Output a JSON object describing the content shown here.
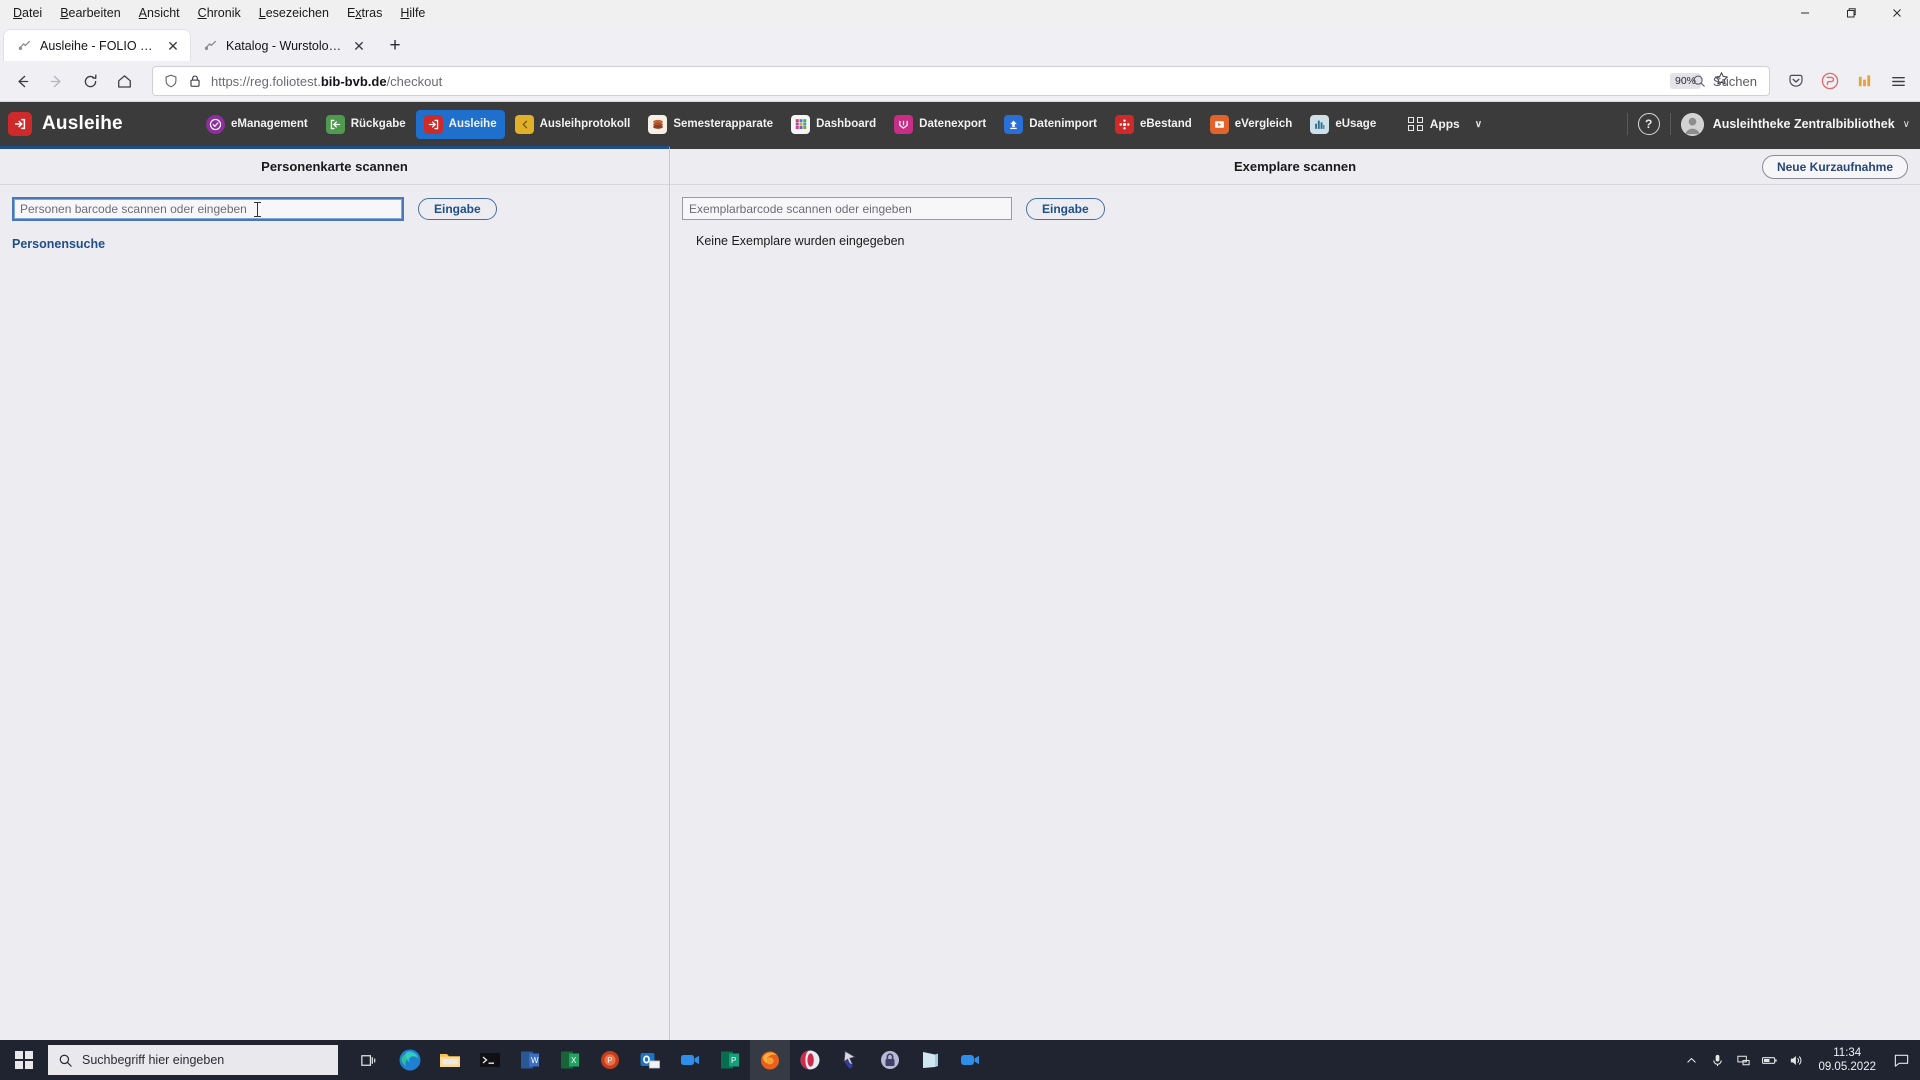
{
  "browser": {
    "menus": [
      {
        "label": "Datei",
        "accel": "D"
      },
      {
        "label": "Bearbeiten",
        "accel": "B"
      },
      {
        "label": "Ansicht",
        "accel": "A"
      },
      {
        "label": "Chronik",
        "accel": "C"
      },
      {
        "label": "Lesezeichen",
        "accel": "L"
      },
      {
        "label": "Extras",
        "accel": "x"
      },
      {
        "label": "Hilfe",
        "accel": "H"
      }
    ],
    "window_controls": {
      "minimize": "minimize-icon",
      "maximize": "maximize-icon",
      "close": "close-icon"
    },
    "tabs": [
      {
        "title": "Ausleihe - FOLIO - FOLIO",
        "active": true,
        "favicon": "page-icon",
        "close": "✕"
      },
      {
        "title": "Katalog - Wurstologia, oder Es",
        "active": false,
        "favicon": "page-icon",
        "close": "✕"
      }
    ],
    "new_tab_label": "+",
    "nav": {
      "back": "back-icon",
      "forward": "forward-icon",
      "reload": "reload-icon",
      "home": "home-icon"
    },
    "urlbar": {
      "shield": "shield-icon",
      "lock": "lock-icon",
      "prefix": "https://reg.foliotest.",
      "domain": "bib-bvb.de",
      "path": "/checkout",
      "zoom_level": "90%",
      "bookmark_star": "star-icon",
      "search_placeholder": "Suchen",
      "search_icon": "search-icon"
    },
    "toolbar_right": [
      {
        "name": "pocket-icon"
      },
      {
        "name": "account-icon"
      },
      {
        "name": "extension-icon"
      },
      {
        "name": "hamburger-menu-icon"
      }
    ]
  },
  "app": {
    "brand": {
      "logo": "ausleihe-logo",
      "name": "Ausleihe"
    },
    "nav_items": [
      {
        "label": "eManagement",
        "icon_color": "#8e2f9e",
        "active": false
      },
      {
        "label": "Rückgabe",
        "icon_color": "#4e9b4e",
        "active": false
      },
      {
        "label": "Ausleihe",
        "icon_color": "#cf2a2a",
        "active": true
      },
      {
        "label": "Ausleihprotokoll",
        "icon_color": "#e0b028",
        "active": false
      },
      {
        "label": "Semesterapparate",
        "icon_color": "#f4f0e6",
        "active": false
      },
      {
        "label": "Dashboard",
        "icon_color": "#f5f5f7",
        "active": false
      },
      {
        "label": "Datenexport",
        "icon_color": "#c92e86",
        "active": false
      },
      {
        "label": "Datenimport",
        "icon_color": "#2a6fd6",
        "active": false
      },
      {
        "label": "eBestand",
        "icon_color": "#cf2a2a",
        "active": false
      },
      {
        "label": "eVergleich",
        "icon_color": "#e2622c",
        "active": false
      },
      {
        "label": "eUsage",
        "icon_color": "#8fb8cf",
        "active": false
      }
    ],
    "apps_button": {
      "label": "Apps",
      "icon": "grid-icon",
      "caret": "∨"
    },
    "help_icon": "help-icon",
    "user": {
      "name": "Ausleihtheke Zentralbibliothek",
      "avatar": "avatar-icon",
      "caret": "∨"
    }
  },
  "main": {
    "left_pane": {
      "title": "Personenkarte scannen",
      "input_placeholder": "Personen barcode scannen oder eingeben",
      "input_value": "",
      "submit_label": "Eingabe",
      "link_label": "Personensuche"
    },
    "right_pane": {
      "title": "Exemplare scannen",
      "action_label": "Neue Kurzaufnahme",
      "input_placeholder": "Exemplarbarcode scannen oder eingeben",
      "input_value": "",
      "submit_label": "Eingabe",
      "empty_message": "Keine Exemplare wurden eingegeben"
    }
  },
  "taskbar": {
    "start": "windows-start-icon",
    "search_placeholder": "Suchbegriff hier eingeben",
    "search_icon": "search-icon",
    "task_view": "task-view-icon",
    "apps": [
      {
        "name": "edge-icon",
        "running": false
      },
      {
        "name": "file-explorer-icon",
        "running": false
      },
      {
        "name": "terminal-icon",
        "running": false
      },
      {
        "name": "word-icon",
        "running": false
      },
      {
        "name": "excel-icon",
        "running": false
      },
      {
        "name": "powerpoint-icon",
        "running": false
      },
      {
        "name": "outlook-icon",
        "running": false
      },
      {
        "name": "teams-icon",
        "running": false
      },
      {
        "name": "publisher-icon",
        "running": false
      },
      {
        "name": "firefox-icon",
        "running": true
      },
      {
        "name": "opera-icon",
        "running": false
      },
      {
        "name": "cursor-tool-icon",
        "running": false
      },
      {
        "name": "keepass-icon",
        "running": false
      },
      {
        "name": "onenote-icon",
        "running": false
      },
      {
        "name": "zoom-icon",
        "running": false
      }
    ],
    "tray": [
      {
        "name": "show-hidden-icons-chevron"
      },
      {
        "name": "microphone-icon"
      },
      {
        "name": "network-icon"
      },
      {
        "name": "battery-icon"
      },
      {
        "name": "volume-icon"
      }
    ],
    "clock": {
      "time": "11:34",
      "date": "09.05.2022"
    },
    "action_center": "action-center-icon"
  },
  "colors": {
    "accent_blue": "#1f6fcc",
    "pane_active_border": "#1f4e8c",
    "app_bar": "#3b3b3b",
    "link": "#1f4e8c",
    "taskbar": "#1f2430"
  }
}
